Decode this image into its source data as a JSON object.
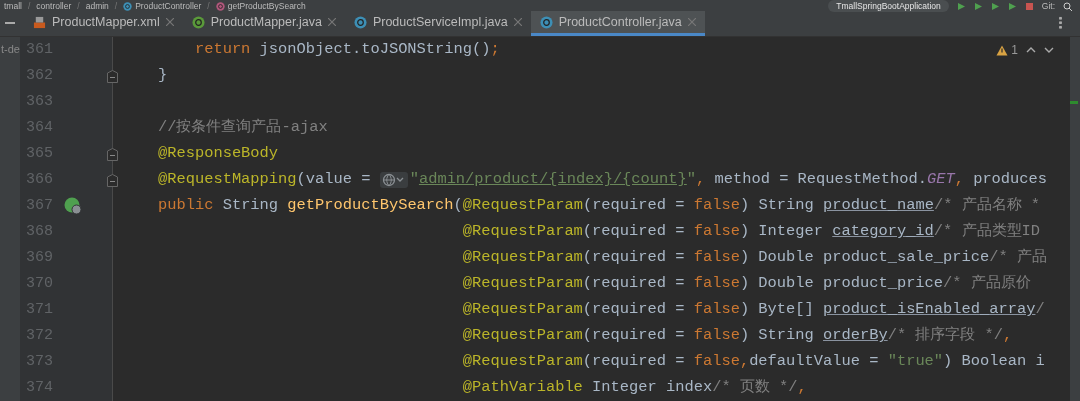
{
  "breadcrumb": [
    {
      "label": "tmall",
      "kind": "folder"
    },
    {
      "separator": "/",
      "label": "controller",
      "kind": "folder"
    },
    {
      "separator": "/",
      "label": "admin",
      "kind": "folder"
    },
    {
      "separator": "/",
      "label": "ProductController",
      "kind": "class"
    },
    {
      "separator": "/",
      "label": "getProductBySearch",
      "kind": "method"
    }
  ],
  "toolbar": {
    "run_config": "TmallSpringBootApplication",
    "vcs_label": "Git:"
  },
  "project_panel": {
    "text": "t-de"
  },
  "tabs": [
    {
      "label": "ProductMapper.xml",
      "kind": "xml",
      "selected": false
    },
    {
      "label": "ProductMapper.java",
      "kind": "interface",
      "selected": false
    },
    {
      "label": "ProductServiceImpl.java",
      "kind": "class",
      "selected": false
    },
    {
      "label": "ProductController.java",
      "kind": "class",
      "selected": true
    }
  ],
  "inspection": {
    "warnings": "1"
  },
  "lines": [
    {
      "number": "361",
      "kind": "nested",
      "tokens": [
        {
          "kind": "kw",
          "s": "return"
        },
        {
          "kind": "plain",
          "s": " jsonObject.toJSONString()"
        },
        {
          "kind": "kw",
          "s": ";"
        }
      ]
    },
    {
      "number": "362",
      "kind": "top",
      "fold_marker": true,
      "tokens": [
        {
          "kind": "plain",
          "s": "}"
        }
      ]
    },
    {
      "number": "363",
      "kind": "top"
    },
    {
      "number": "364",
      "kind": "top",
      "tokens": [
        {
          "kind": "comment",
          "s": "//按条件查询产品-ajax"
        }
      ]
    },
    {
      "number": "365",
      "kind": "top",
      "fold_marker": true,
      "tokens": [
        {
          "kind": "anno",
          "s": "@ResponseBody"
        }
      ]
    },
    {
      "number": "366",
      "kind": "top",
      "fold_marker": true,
      "tokens": [
        {
          "kind": "anno",
          "s": "@RequestMapping"
        },
        {
          "kind": "plain",
          "s": "(value = "
        },
        {
          "kind": "chip"
        },
        {
          "kind": "string",
          "s": "\""
        },
        {
          "kind": "link",
          "s": "admin/product/{index}/{count}"
        },
        {
          "kind": "string",
          "s": "\""
        },
        {
          "kind": "kw",
          "s": ", "
        },
        {
          "kind": "plain",
          "s": "method = RequestMethod."
        },
        {
          "kind": "const",
          "s": "GET"
        },
        {
          "kind": "kw",
          "s": ", "
        },
        {
          "kind": "plain",
          "s": "produces"
        }
      ]
    },
    {
      "number": "367",
      "kind": "top",
      "run_marker": true,
      "tokens": [
        {
          "kind": "kw",
          "s": "public "
        },
        {
          "kind": "plain",
          "s": "String "
        },
        {
          "kind": "method",
          "s": "getProductBySearch"
        },
        {
          "kind": "plain",
          "s": "("
        },
        {
          "kind": "anno",
          "s": "@RequestParam"
        },
        {
          "kind": "plain",
          "s": "(required = "
        },
        {
          "kind": "kw",
          "s": "false"
        },
        {
          "kind": "plain",
          "s": ") String "
        },
        {
          "kind": "param",
          "s": "product_name"
        },
        {
          "kind": "comment",
          "s": "/* 产品名称 *"
        }
      ]
    },
    {
      "number": "368",
      "kind": "continuation",
      "tokens": [
        {
          "kind": "anno",
          "s": "@RequestParam"
        },
        {
          "kind": "plain",
          "s": "(required = "
        },
        {
          "kind": "kw",
          "s": "false"
        },
        {
          "kind": "plain",
          "s": ") Integer "
        },
        {
          "kind": "param",
          "s": "category_id"
        },
        {
          "kind": "comment",
          "s": "/* 产品类型ID"
        }
      ]
    },
    {
      "number": "369",
      "kind": "continuation",
      "tokens": [
        {
          "kind": "anno",
          "s": "@RequestParam"
        },
        {
          "kind": "plain",
          "s": "(required = "
        },
        {
          "kind": "kw",
          "s": "false"
        },
        {
          "kind": "plain",
          "s": ") Double product_sale_price"
        },
        {
          "kind": "comment",
          "s": "/* 产品"
        }
      ]
    },
    {
      "number": "370",
      "kind": "continuation",
      "tokens": [
        {
          "kind": "anno",
          "s": "@RequestParam"
        },
        {
          "kind": "plain",
          "s": "(required = "
        },
        {
          "kind": "kw",
          "s": "false"
        },
        {
          "kind": "plain",
          "s": ") Double product_price"
        },
        {
          "kind": "comment",
          "s": "/* 产品原价"
        }
      ]
    },
    {
      "number": "371",
      "kind": "continuation",
      "tokens": [
        {
          "kind": "anno",
          "s": "@RequestParam"
        },
        {
          "kind": "plain",
          "s": "(required = "
        },
        {
          "kind": "kw",
          "s": "false"
        },
        {
          "kind": "plain",
          "s": ") Byte[] "
        },
        {
          "kind": "param",
          "s": "product_isEnabled_array"
        },
        {
          "kind": "comment",
          "s": "/"
        }
      ]
    },
    {
      "number": "372",
      "kind": "continuation",
      "tokens": [
        {
          "kind": "anno",
          "s": "@RequestParam"
        },
        {
          "kind": "plain",
          "s": "(required = "
        },
        {
          "kind": "kw",
          "s": "false"
        },
        {
          "kind": "plain",
          "s": ") String "
        },
        {
          "kind": "param",
          "s": "orderBy"
        },
        {
          "kind": "comment",
          "s": "/* 排序字段 */"
        },
        {
          "kind": "kw",
          "s": ","
        }
      ]
    },
    {
      "number": "373",
      "kind": "continuation",
      "tokens": [
        {
          "kind": "anno",
          "s": "@RequestParam"
        },
        {
          "kind": "plain",
          "s": "(required = "
        },
        {
          "kind": "kw",
          "s": "false,"
        },
        {
          "kind": "plain",
          "s": "defaultValue = "
        },
        {
          "kind": "string",
          "s": "\"true\""
        },
        {
          "kind": "plain",
          "s": ") Boolean i"
        }
      ]
    },
    {
      "number": "374",
      "kind": "continuation",
      "tokens": [
        {
          "kind": "anno",
          "s": "@PathVariable"
        },
        {
          "kind": "plain",
          "s": " Integer index"
        },
        {
          "kind": "comment",
          "s": "/* 页数 */"
        },
        {
          "kind": "kw",
          "s": ","
        }
      ]
    }
  ]
}
